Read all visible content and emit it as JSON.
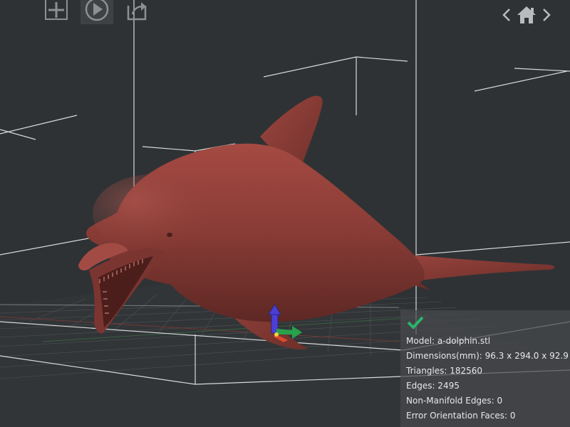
{
  "toolbar": {
    "add_icon": "plus-icon",
    "play_icon": "play-icon",
    "export_icon": "export-icon"
  },
  "navigation": {
    "back_icon": "chevron-left-icon",
    "home_icon": "home-icon",
    "forward_icon": "chevron-right-icon"
  },
  "model": {
    "status_icon": "checkmark-icon",
    "name_line": "Model: a-dolphin.stl",
    "dimensions_line": "Dimensions(mm): 96.3 x 294.0 x 92.9",
    "triangles_line": "Triangles: 182560",
    "edges_line": "Edges: 2495",
    "non_manifold_line": "Non-Manifold Edges: 0",
    "error_orientation_line": "Error Orientation Faces: 0"
  },
  "colors": {
    "background": "#2f3234",
    "model": "#8a3c36",
    "grid": "#585c5e",
    "check": "#2bb36b",
    "gizmo_z": "#4b3fd6",
    "gizmo_y": "#27a24b",
    "gizmo_x": "#d84a2e"
  }
}
